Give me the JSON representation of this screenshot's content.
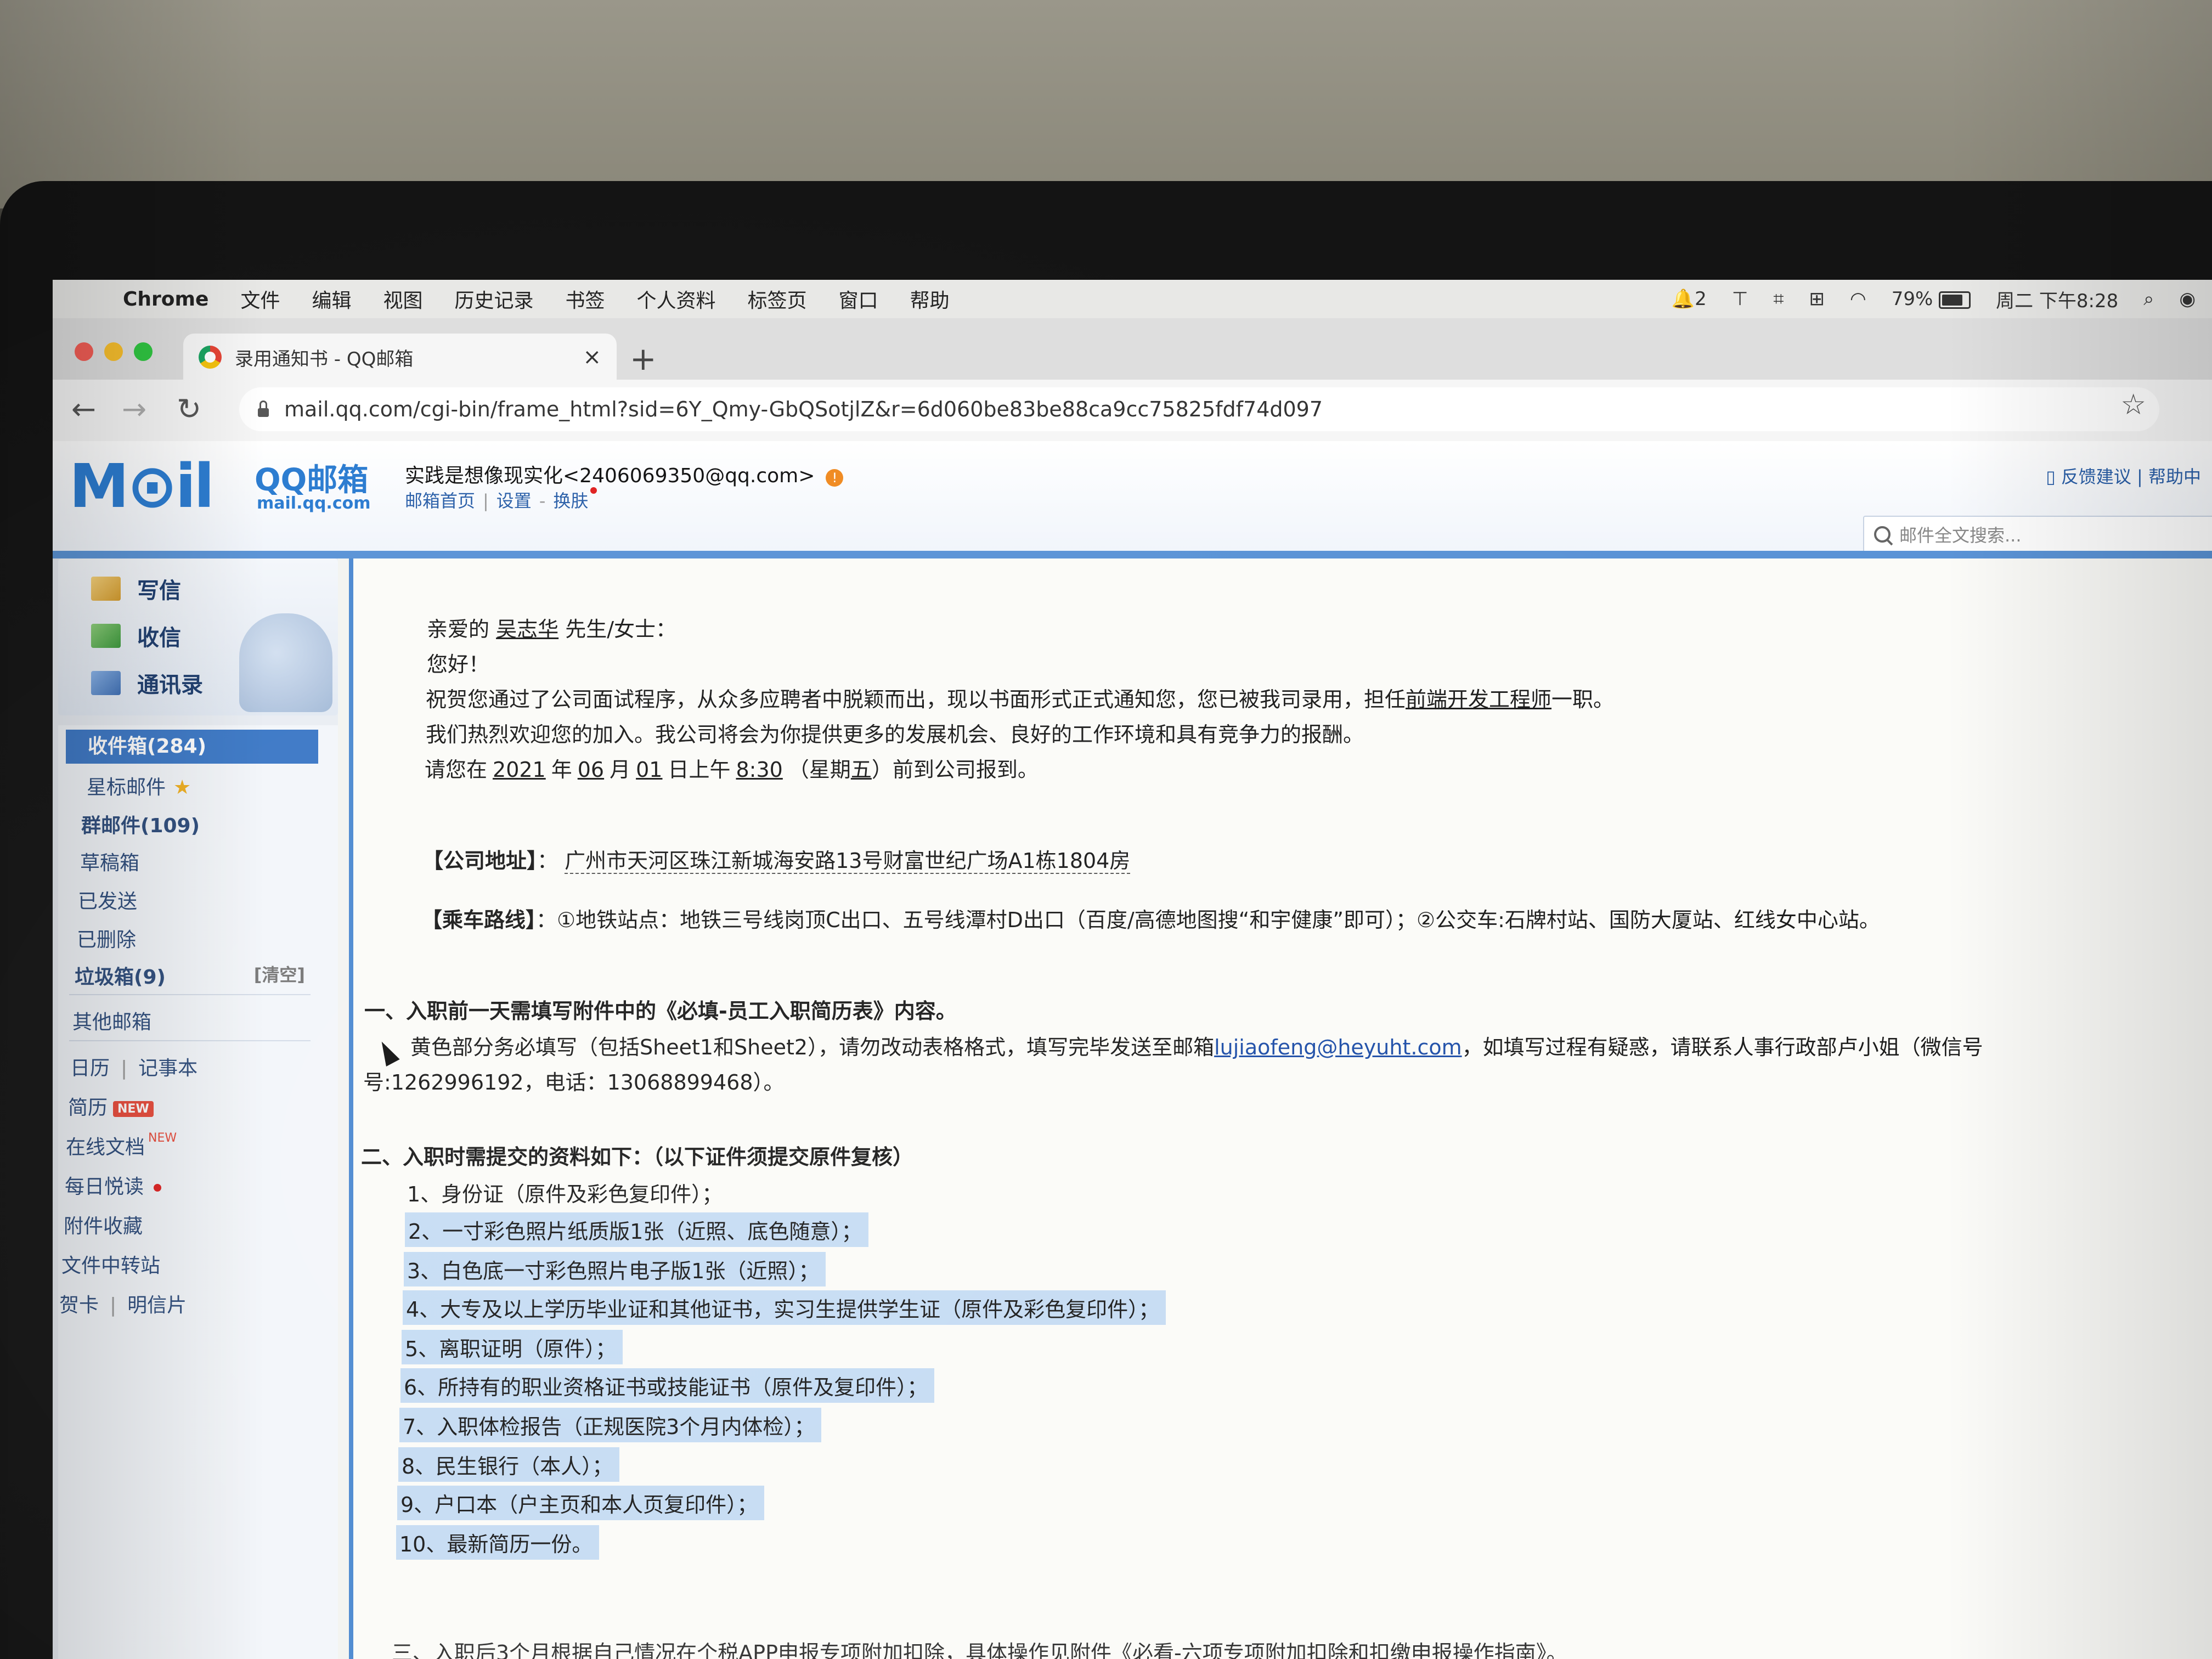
{
  "menubar": {
    "app": "Chrome",
    "items": [
      "文件",
      "编辑",
      "视图",
      "历史记录",
      "书签",
      "个人资料",
      "标签页",
      "窗口",
      "帮助"
    ],
    "status": {
      "notification_count": "2",
      "battery": "79%",
      "clock": "周二 下午8:28"
    }
  },
  "browser": {
    "tab_title": "录用通知书 - QQ邮箱",
    "tab_close": "×",
    "new_tab": "+",
    "url": "mail.qq.com/cgi-bin/frame_html?sid=6Y_Qmy-GbQSotjlZ&r=6d060be83be88ca9cc75825fdf74d097"
  },
  "mail_header": {
    "logo_text": "M⊙il",
    "logo_product": "QQ邮箱",
    "logo_domain": "mail.qq.com",
    "account": "实践是想像现实化<2406069350@qq.com>",
    "warn": "!",
    "links": [
      "邮箱首页",
      "设置",
      "换肤"
    ],
    "top_right": "反馈建议 | 帮助中",
    "search_placeholder": "邮件全文搜索..."
  },
  "sidebar": {
    "actions": [
      "写信",
      "收信",
      "通讯录"
    ],
    "inbox": "收件箱(284)",
    "starred": "星标邮件",
    "group": "群邮件(109)",
    "drafts": "草稿箱",
    "sent": "已发送",
    "deleted": "已删除",
    "trash": "垃圾箱(9)",
    "trash_clear": "[清空]",
    "other": "其他邮箱",
    "calendar": "日历",
    "notes": "记事本",
    "resume": "简历",
    "resume_badge": "NEW",
    "docs": "在线文档",
    "docs_badge": "NEW",
    "daily": "每日悦读",
    "attachments": "附件收藏",
    "transfer": "文件中转站",
    "cards": "贺卡",
    "postcards": "明信片"
  },
  "email": {
    "greeting_prefix": "亲爱的",
    "name": "吴志华",
    "greeting_suffix": "先生/女士：",
    "hello": "您好！",
    "p1_prefix": "祝贺您通过了公司面试程序，从众多应聘者中脱颖而出，现以书面形式正式通知您，您已被我司录用，担任",
    "position": "前端开发工程师",
    "p1_suffix": "一职。",
    "p2": "我们热烈欢迎您的加入。我公司将会为你提供更多的发展机会、良好的工作环境和具有竞争力的报酬。",
    "report": {
      "prefix": "请您在",
      "year": "2021",
      "year_label": "年",
      "month": "06",
      "month_label": "月",
      "day": "01",
      "day_label": "日上午",
      "time": "8:30",
      "week_prefix": "（星期",
      "weekday": "五",
      "suffix": "）前到公司报到。"
    },
    "address_label": "【公司地址】",
    "address_colon": "：",
    "address": "广州市天河区珠江新城海安路13号财富世纪广场A1栋1804房",
    "route_label": "【乘车路线】",
    "route": "：①地铁站点：地铁三号线岗顶C出口、五号线潭村D出口（百度/高德地图搜“和宇健康”即可）；②公交车:石牌村站、国防大厦站、红线女中心站。",
    "section1_title": "一、入职前一天需填写附件中的《必填-员工入职简历表》内容。",
    "section1_line_prefix": "黄色部分务必填写（包括Sheet1和Sheet2），请勿改动表格格式，填写完毕发送至邮箱",
    "section1_email": "lujiaofeng@heyuht.com",
    "section1_line_suffix": "，如填写过程有疑惑，请联系人事行政部卢小姐（微信号",
    "section1_line2": "号:1262996192，电话：13068899468）。",
    "section2_title": "二、入职时需提交的资料如下：（以下证件须提交原件复核）",
    "items": [
      "1、身份证（原件及彩色复印件）；",
      "2、一寸彩色照片纸质版1张（近照、底色随意）；",
      "3、白色底一寸彩色照片电子版1张（近照）；",
      "4、大专及以上学历毕业证和其他证书，实习生提供学生证（原件及彩色复印件）；",
      "5、离职证明（原件）；",
      "6、所持有的职业资格证书或技能证书（原件及复印件）；",
      "7、入职体检报告（正规医院3个月内体检）；",
      "8、民生银行（本人）；",
      "9、户口本（户主页和本人页复印件）；",
      "10、最新简历一份。"
    ],
    "bottom_partial": "三、入职后3个月根据自己情况在个税APP申报专项附加扣除，具体操作见附件《必看-六项专项附加扣除和扣缴申报操作指南》。"
  }
}
